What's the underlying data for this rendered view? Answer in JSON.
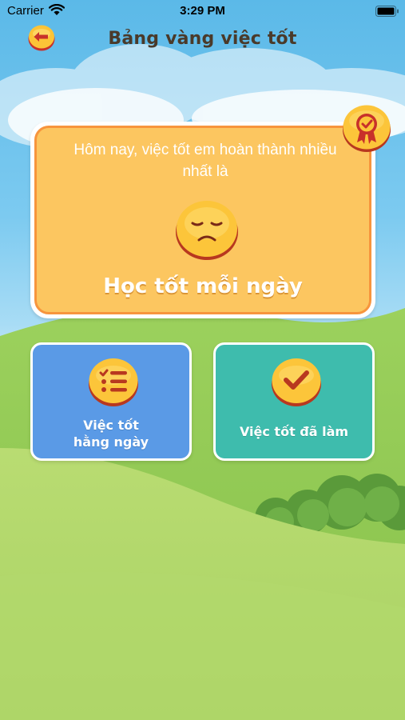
{
  "status_bar": {
    "carrier": "Carrier",
    "time": "3:29 PM",
    "icons": [
      "wifi-icon",
      "battery-icon"
    ]
  },
  "header": {
    "title": "Bảng vàng việc tốt",
    "back_icon": "arrow-left-icon"
  },
  "top_card": {
    "caption": "Hôm nay, việc tốt em hoàn thành nhiều nhất là",
    "value": "Học tốt mỗi ngày",
    "face_icon": "sad-face-icon",
    "badge_icon": "medal-icon"
  },
  "menu": {
    "daily": {
      "line1": "Việc tốt",
      "line2": "hằng ngày",
      "icon": "checklist-icon"
    },
    "done": {
      "label": "Việc tốt đã làm",
      "icon": "checkmark-icon"
    }
  },
  "colors": {
    "sky": "#5bb9e8",
    "card_orange": "#fcc660",
    "card_border": "#f7953d",
    "daily_blue": "#5a9ae6",
    "done_teal": "#3ebcad",
    "grass": "#a8d160",
    "title_text": "#4a3a2a"
  }
}
